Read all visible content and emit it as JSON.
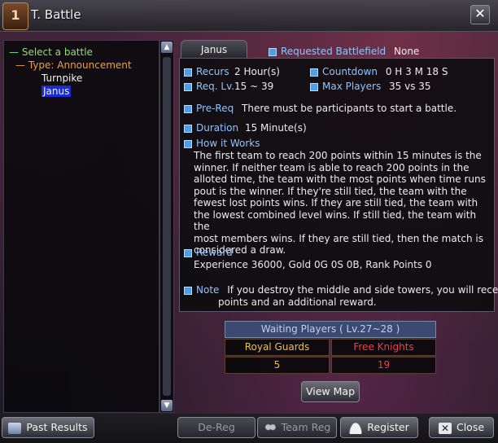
{
  "window": {
    "title": "T. Battle",
    "icon_glyph": "1",
    "close_glyph": "✕"
  },
  "tree": {
    "root": "Select a battle",
    "type": "Type: Announcement",
    "items": [
      "Turnpike",
      "Janus"
    ],
    "selected": "Janus"
  },
  "tab": {
    "label": "Janus"
  },
  "requested": {
    "label": "Requested Battlefield",
    "value": "None"
  },
  "info": {
    "recurs_label": "Recurs",
    "recurs_value": "2 Hour(s)",
    "countdown_label": "Countdown",
    "countdown_value": "0 H 3 M 18 S",
    "reqlv_label": "Req. Lv.",
    "reqlv_value": "15 ~ 39",
    "maxplayers_label": "Max Players",
    "maxplayers_value": "35 vs 35",
    "prereq_label": "Pre-Req",
    "prereq_value": "There must be participants to start a battle.",
    "duration_label": "Duration",
    "duration_value": "15 Minute(s)",
    "how_label": "How it Works",
    "how_lines": [
      "The first team to reach 200 points within 15 minutes is the",
      "winner. If neither team is able to reach 200 points in the",
      "alloted time, the team with the most points when time runs",
      "pout is the winner. If they're still tied, the team with the",
      "fewest lost points wins. If they are still tied, the team with",
      "the lowest combined level wins. If still tied, the team with the",
      "most members wins. If they are still tied, then the match is",
      "considered a draw."
    ],
    "reward_label": "Reward",
    "reward_value": "Experience 36000, Gold 0G 0S 0B, Rank Points 0",
    "note_label": "Note",
    "note_line1": "If you destroy the middle and side towers, you will receive",
    "note_line2": "points and an additional reward."
  },
  "waiting": {
    "header": "Waiting Players ( Lv.27~28 )",
    "team1_name": "Royal Guards",
    "team1_count": "5",
    "team2_name": "Free Knights",
    "team2_count": "19"
  },
  "buttons": {
    "view_map": "View Map",
    "past_results": "Past Results",
    "dereg": "De-Reg",
    "team_reg": "Team Reg",
    "register": "Register",
    "close": "Close"
  },
  "colors": {
    "accent_blue": "#8ec4ff",
    "team1": "#f0c040",
    "team2": "#ff3a3a",
    "tree_green": "#8fe070",
    "tree_orange": "#f0a03a"
  }
}
